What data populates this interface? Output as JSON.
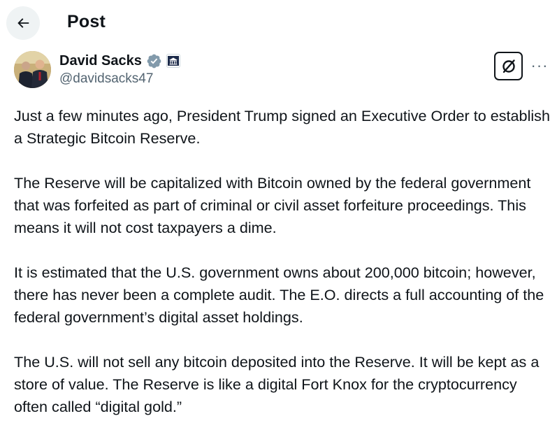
{
  "header": {
    "title": "Post",
    "back_icon": "arrow-left-icon"
  },
  "author": {
    "name": "David Sacks",
    "handle": "@davidsacks47",
    "verified_icon": "verified-badge-icon",
    "affiliation_icon": "white-house-badge-icon"
  },
  "actions": {
    "grok_icon": "grok-icon",
    "more_label": "···"
  },
  "tweet": {
    "paragraphs": [
      "Just a few minutes ago, President Trump signed an Executive Order to establish a Strategic Bitcoin Reserve.",
      "The Reserve will be capitalized with Bitcoin owned by the federal government that was forfeited as part of criminal or civil asset forfeiture proceedings. This means it will not cost taxpayers a dime.",
      "It is estimated that the U.S. government owns about 200,000 bitcoin; however, there has never been a complete audit. The E.O. directs a full accounting of the federal government’s digital asset holdings.",
      "The U.S. will not sell any bitcoin deposited into the Reserve. It will be kept as a store of value. The Reserve is like a digital Fort Knox for the cryptocurrency often called “digital gold.”"
    ]
  },
  "colors": {
    "text": "#0f1419",
    "secondary": "#536471",
    "verified": "#829aab",
    "back_bg": "#eff3f4"
  }
}
